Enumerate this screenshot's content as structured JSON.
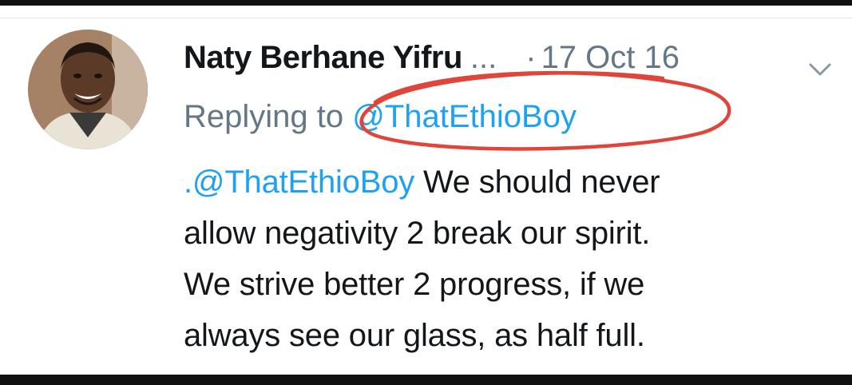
{
  "tweet": {
    "author": {
      "display_name": "Naty Berhane Yifru",
      "name_truncation": "...",
      "avatar_icon": "person-avatar-icon"
    },
    "separator": "·",
    "timestamp": "17 Oct 16",
    "menu_icon": "chevron-down-icon",
    "reply_context": {
      "prefix": "Replying to",
      "handle": "@ThatEthioBoy"
    },
    "body": {
      "mention": ".@ThatEthioBoy",
      "lines": [
        " We should never",
        "allow negativity 2 break our spirit.",
        "We strive better 2 progress, if we",
        "always see our glass, as half full."
      ]
    }
  },
  "colors": {
    "text": "#14171a",
    "secondary": "#657786",
    "link": "#1da1f2",
    "annotation_circle": "#e0453a"
  }
}
